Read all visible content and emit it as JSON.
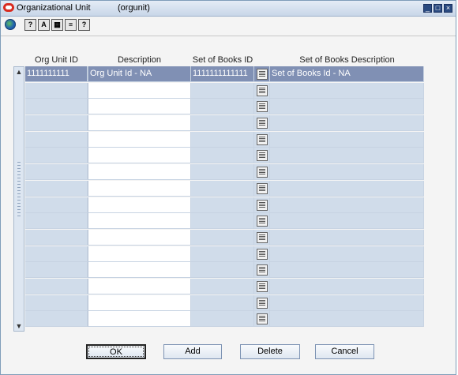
{
  "window": {
    "title": "Organizational Unit",
    "code": "(orgunit)"
  },
  "toolbar": {
    "icons": [
      "globe-icon",
      "help-cursor-icon",
      "spell-check-icon",
      "calendar-icon",
      "editor-icon",
      "help-icon"
    ]
  },
  "columns": [
    "Org Unit ID",
    "Description",
    "Set of Books ID",
    "Set of Books Description"
  ],
  "rows": [
    [
      "1111111111",
      "Org Unit Id - NA",
      "1111111111111",
      "Set of Books Id - NA"
    ],
    [
      "",
      "",
      "",
      ""
    ],
    [
      "",
      "",
      "",
      ""
    ],
    [
      "",
      "",
      "",
      ""
    ],
    [
      "",
      "",
      "",
      ""
    ],
    [
      "",
      "",
      "",
      ""
    ],
    [
      "",
      "",
      "",
      ""
    ],
    [
      "",
      "",
      "",
      ""
    ],
    [
      "",
      "",
      "",
      ""
    ],
    [
      "",
      "",
      "",
      ""
    ],
    [
      "",
      "",
      "",
      ""
    ],
    [
      "",
      "",
      "",
      ""
    ],
    [
      "",
      "",
      "",
      ""
    ],
    [
      "",
      "",
      "",
      ""
    ],
    [
      "",
      "",
      "",
      ""
    ],
    [
      "",
      "",
      "",
      ""
    ]
  ],
  "buttons": {
    "ok": "OK",
    "add": "Add",
    "delete": "Delete",
    "cancel": "Cancel"
  }
}
